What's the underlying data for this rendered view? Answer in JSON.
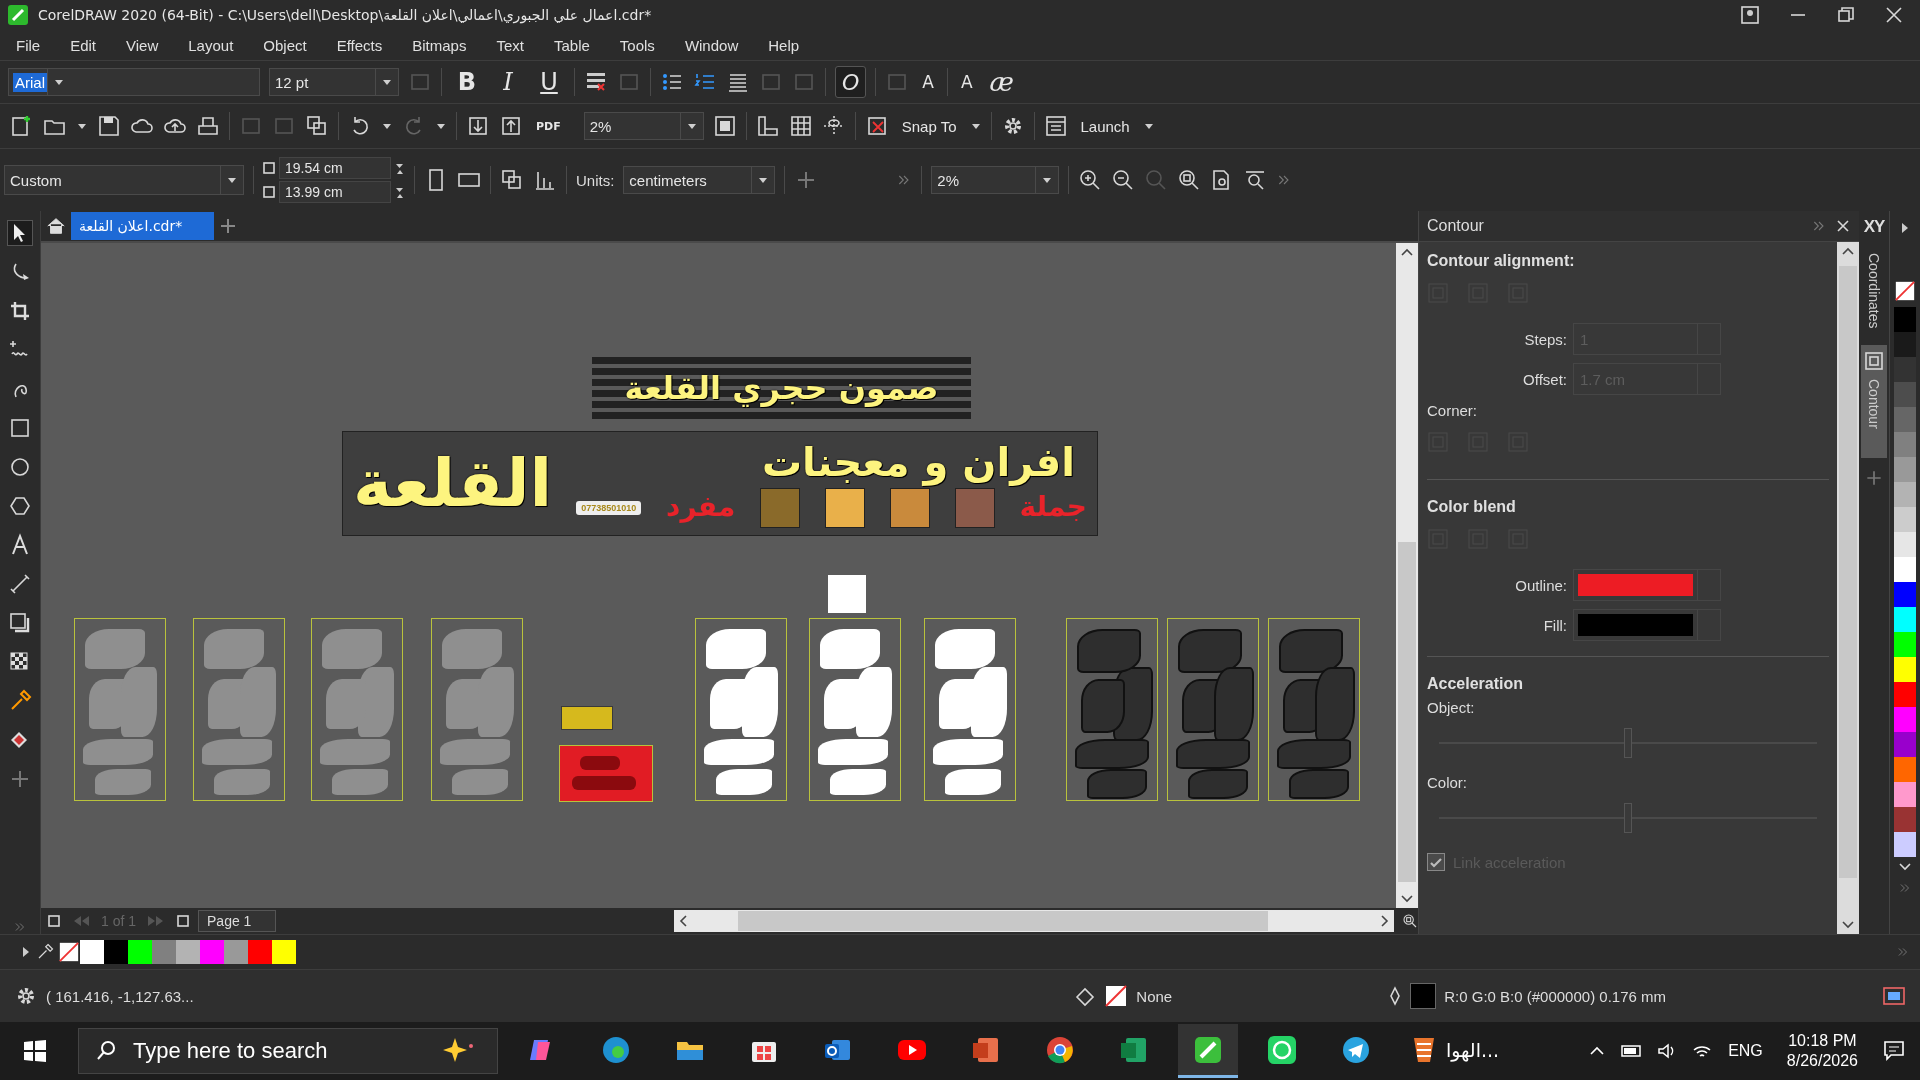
{
  "window": {
    "title": "CorelDRAW 2020 (64-Bit) - C:\\Users\\dell\\Desktop\\اعمال علي الجبوري\\اعمالي\\اعلان القلعة.cdr*"
  },
  "menu": [
    "File",
    "Edit",
    "View",
    "Layout",
    "Object",
    "Effects",
    "Bitmaps",
    "Text",
    "Table",
    "Tools",
    "Window",
    "Help"
  ],
  "font_bar": {
    "font": "Arial",
    "size": "12 pt",
    "format_buttons": [
      {
        "label": "B",
        "kind": "bold"
      },
      {
        "label": "I",
        "kind": "italic"
      },
      {
        "label": "U",
        "kind": "underline"
      }
    ],
    "glyph_buttons": [
      "O",
      "A",
      "A",
      "æ"
    ]
  },
  "toolbar": {
    "pdf_label": "PDF",
    "zoom": "2%",
    "snap": "Snap To",
    "launch": "Launch"
  },
  "property_bar": {
    "preset": "Custom",
    "width": "19.54 cm",
    "height": "13.99 cm",
    "units_label": "Units:",
    "units": "centimeters",
    "zoom": "2%"
  },
  "tabs": [
    {
      "label": "اعلان القلعة.cdr*",
      "selected": true
    }
  ],
  "canvas": {
    "banner_top": "صمون حجري القلعة",
    "banner_title": "افران و معجنات",
    "banner_logo": "القلعة",
    "retail": "مفرد",
    "wholesale": "جملة",
    "phone": "07738501010",
    "tiles": [
      {
        "kind": "grey"
      },
      {
        "kind": "grey"
      },
      {
        "kind": "grey"
      },
      {
        "kind": "grey"
      },
      {
        "kind": "white"
      },
      {
        "kind": "white"
      },
      {
        "kind": "white"
      },
      {
        "kind": "outline"
      },
      {
        "kind": "outline"
      },
      {
        "kind": "outline"
      }
    ]
  },
  "page_nav": {
    "count": "1 of 1",
    "page": "Page 1"
  },
  "docker": {
    "title": "Contour",
    "alignment": "Contour alignment:",
    "steps_label": "Steps:",
    "steps": "1",
    "offset_label": "Offset:",
    "offset": "1.7 cm",
    "corner": "Corner:",
    "color_blend": "Color blend",
    "color_pickers": [
      {
        "label": "Outline:",
        "color": "#ed1c24"
      },
      {
        "label": "Fill:",
        "color": "#000000"
      }
    ],
    "acceleration": "Acceleration",
    "sliders": [
      {
        "label": "Object:",
        "level": 0.5
      },
      {
        "label": "Color:",
        "level": 0.5
      }
    ],
    "link": {
      "label": "Link acceleration",
      "checked": true,
      "disabled": true
    }
  },
  "side_tabs": [
    {
      "label": "XY",
      "kind": "text"
    },
    {
      "label": "Coordinates",
      "kind": "tab",
      "selected": false
    },
    {
      "label": "Contour",
      "kind": "tab",
      "selected": true
    }
  ],
  "palette": [
    {
      "color": "#000000"
    },
    {
      "color": "#1a1a1a"
    },
    {
      "color": "#333333"
    },
    {
      "color": "#4d4d4d"
    },
    {
      "color": "#666666"
    },
    {
      "color": "#808080"
    },
    {
      "color": "#999999"
    },
    {
      "color": "#b3b3b3"
    },
    {
      "color": "#cccccc"
    },
    {
      "color": "#e6e6e6"
    },
    {
      "color": "#ffffff"
    },
    {
      "color": "#0000ff"
    },
    {
      "color": "#00ffff"
    },
    {
      "color": "#00ff00"
    },
    {
      "color": "#ffff00"
    },
    {
      "color": "#ff0000"
    },
    {
      "color": "#ff00ff"
    },
    {
      "color": "#9900cc"
    },
    {
      "color": "#ff6600"
    },
    {
      "color": "#ff99cc"
    },
    {
      "color": "#993333"
    },
    {
      "color": "#ccccff"
    }
  ],
  "document_palette": [
    {
      "color": "#ffffff"
    },
    {
      "color": "#000000"
    },
    {
      "color": "#00ff00"
    },
    {
      "color": "#808080"
    },
    {
      "color": "#b3b3b3"
    },
    {
      "color": "#ff00ff"
    },
    {
      "color": "#999999"
    },
    {
      "color": "#ff0000"
    },
    {
      "color": "#ffff00"
    }
  ],
  "status": {
    "coords": "( 161.416, -1,127.63...",
    "fill": "None",
    "outline": "R:0 G:0 B:0 (#000000)  0.176 mm"
  },
  "taskbar": {
    "search": "Type here to search",
    "apps": [
      {
        "kind": "copilot",
        "selected": false
      },
      {
        "kind": "edge",
        "selected": false
      },
      {
        "kind": "files",
        "selected": false
      },
      {
        "kind": "store",
        "selected": false
      },
      {
        "kind": "outlook",
        "selected": false
      },
      {
        "kind": "youtube",
        "selected": false
      },
      {
        "kind": "powerpoint",
        "selected": false
      },
      {
        "kind": "chrome",
        "selected": false
      },
      {
        "kind": "excel",
        "selected": false
      },
      {
        "kind": "corel",
        "selected": true
      },
      {
        "kind": "whatsapp",
        "selected": false
      },
      {
        "kind": "telegram",
        "selected": false
      }
    ],
    "window_label": "الهوا...",
    "lang": "ENG",
    "time": "10:18 PM",
    "date": "8/26/2026"
  }
}
